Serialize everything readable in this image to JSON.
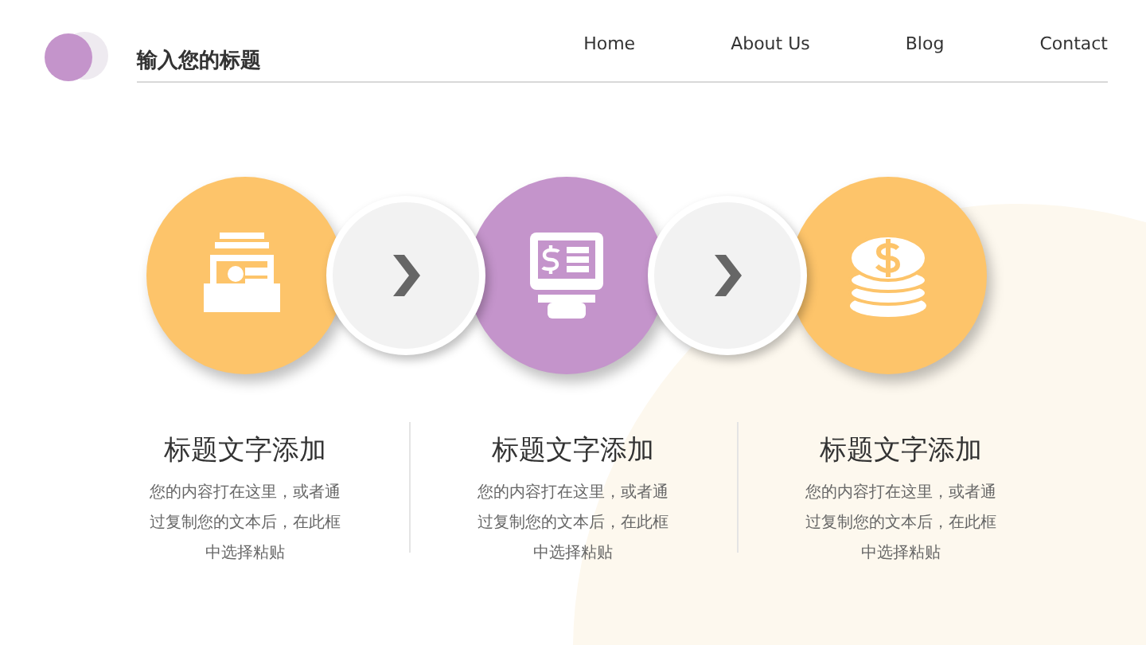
{
  "header": {
    "title": "输入您的标题",
    "nav": [
      {
        "label": "Home"
      },
      {
        "label": "About Us"
      },
      {
        "label": "Blog"
      },
      {
        "label": "Contact"
      }
    ]
  },
  "steps": [
    {
      "kind": "cardfile",
      "color": "#fdc46a"
    },
    {
      "kind": "kiosk",
      "color": "#c494cb"
    },
    {
      "kind": "coins",
      "color": "#fdc46a"
    }
  ],
  "columns": [
    {
      "title": "标题文字添加",
      "body": "您的内容打在这里，或者通过复制您的文本后，在此框中选择粘贴"
    },
    {
      "title": "标题文字添加",
      "body": "您的内容打在这里，或者通过复制您的文本后，在此框中选择粘贴"
    },
    {
      "title": "标题文字添加",
      "body": "您的内容打在这里，或者通过复制您的文本后，在此框中选择粘贴"
    }
  ]
}
